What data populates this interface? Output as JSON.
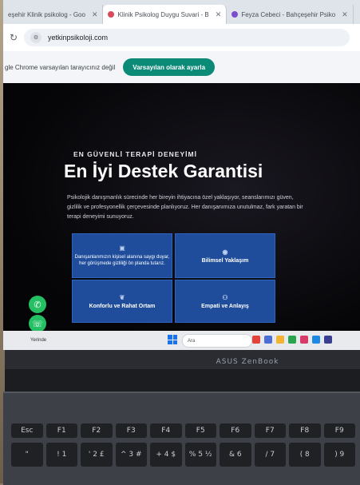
{
  "browser": {
    "tabs": [
      {
        "label": "eşehir Klinik psikolog - Goo",
        "active": false
      },
      {
        "label": "Klinik Psikolog Duygu Suvari - B",
        "active": true
      },
      {
        "label": "Feyza Cebeci - Bahçeşehir Psiko",
        "active": false
      }
    ],
    "url": "yetkinpsikoloji.com",
    "info_text": "gle Chrome varsayılan tarayıcınız değil",
    "default_button": "Varsayılan olarak ayarla"
  },
  "page": {
    "eyebrow": "EN GÜVENLİ TERAPİ DENEYİMİ",
    "headline": "En İyi Destek Garantisi",
    "lead": "Psikolojik danışmanlık sürecinde her bireyin ihtiyacına özel yaklaşıyor, seanslarımızı güven, gizlilik ve profesyonellik çerçevesinde planlıyoruz. Her danışanımıza unutulmaz, fark yaratan bir terapi deneyimi sunuyoruz.",
    "cards": [
      {
        "text": "Danışanlarımızın kişisel alanına saygı duyar, her görüşmede gizliliği ön planda tutarız."
      },
      {
        "text": "Bilimsel Yaklaşım"
      },
      {
        "text": "Konforlu ve Rahat Ortam"
      },
      {
        "text": "Empati ve Anlayış"
      }
    ]
  },
  "taskbar": {
    "weather": "Yerinde",
    "search_placeholder": "Ara"
  },
  "laptop": {
    "brand": "ASUS ZenBook",
    "keys_row1": [
      "Esc",
      "F1",
      "F2",
      "F3",
      "F4",
      "F5",
      "F6",
      "F7",
      "F8",
      "F9"
    ],
    "keys_row2": [
      "\"",
      "! 1",
      "' 2 £",
      "^ 3 #",
      "+ 4 $",
      "% 5 ½",
      "& 6",
      "/ 7",
      "( 8",
      ") 9"
    ]
  },
  "colors": {
    "card_blue": "#1f4d9c",
    "whatsapp_green": "#25c064",
    "default_button": "#0b8a78"
  }
}
